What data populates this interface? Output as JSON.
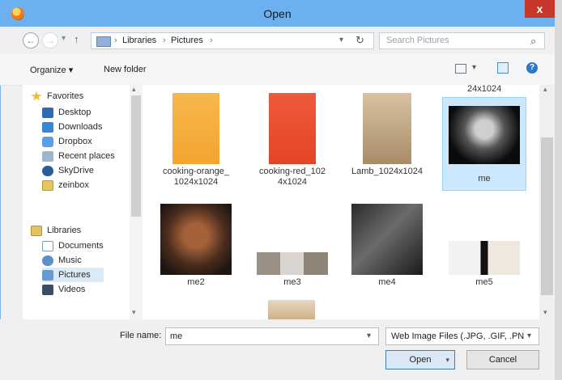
{
  "window": {
    "title": "Open",
    "close_glyph": "x"
  },
  "nav": {
    "back_glyph": "←",
    "forward_glyph": "→",
    "history_glyph": "▾",
    "up_glyph": "↑",
    "breadcrumb": [
      "Libraries",
      "Pictures"
    ],
    "separator": "›",
    "dropdown_glyph": "▾",
    "refresh_glyph": "↻",
    "search_placeholder": "Search Pictures",
    "search_glyph": "⌕"
  },
  "toolbar": {
    "organize_label": "Organize ▾",
    "new_folder_label": "New folder",
    "view_glyph": "▾",
    "help_glyph": "?"
  },
  "sidebar": {
    "favorites_label": "Favorites",
    "favorites": [
      "Desktop",
      "Downloads",
      "Dropbox",
      "Recent places",
      "SkyDrive",
      "zeinbox"
    ],
    "libraries_label": "Libraries",
    "libraries": [
      "Documents",
      "Music",
      "Pictures",
      "Videos"
    ],
    "scroll_up": "▴",
    "scroll_down": "▾"
  },
  "files": {
    "top_caption": "24x1024",
    "items": [
      {
        "label_line1": "cooking-orange_",
        "label_line2": "1024x1024"
      },
      {
        "label_line1": "cooking-red_102",
        "label_line2": "4x1024"
      },
      {
        "label_line1": "Lamb_1024x1024",
        "label_line2": ""
      },
      {
        "label_line1": "me",
        "label_line2": ""
      },
      {
        "label_line1": "me2",
        "label_line2": ""
      },
      {
        "label_line1": "me3",
        "label_line2": ""
      },
      {
        "label_line1": "me4",
        "label_line2": ""
      },
      {
        "label_line1": "me5",
        "label_line2": ""
      }
    ],
    "scroll_up": "▴",
    "scroll_down": "▾"
  },
  "bottom": {
    "file_name_label": "File name:",
    "file_name_value": "me",
    "file_name_dropdown": "▾",
    "file_type_value": "Web Image Files (.JPG, .GIF, .PN",
    "file_type_dropdown": "▾",
    "open_label": "Open",
    "open_dropdown": "▾",
    "cancel_label": "Cancel"
  },
  "colors": {
    "titlebar": "#6bb0ef",
    "close": "#c7382c",
    "selection": "#cce8ff"
  }
}
